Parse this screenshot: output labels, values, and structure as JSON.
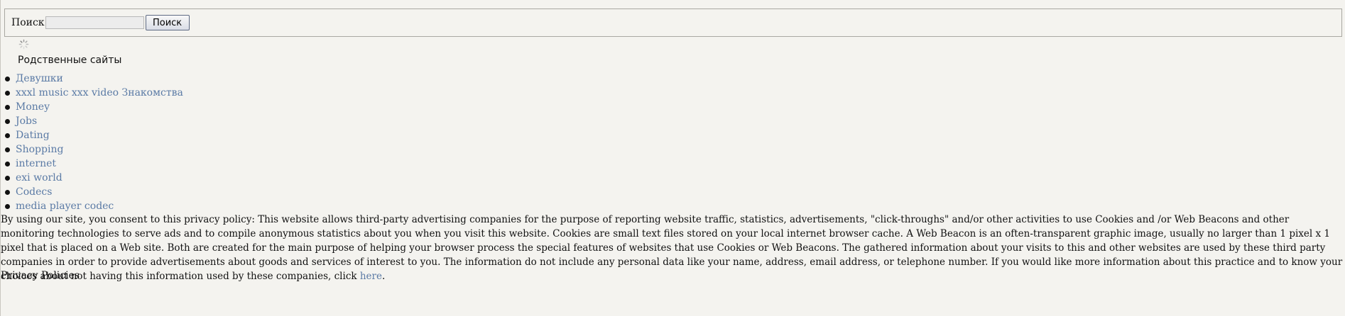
{
  "search": {
    "label": "Поиск",
    "input_value": "",
    "button_label": "Поиск"
  },
  "related": {
    "heading": "Родственные сайты",
    "links": [
      "Девушки",
      "xxxl music xxx video Знакомства",
      "Money",
      "Jobs",
      "Dating",
      "Shopping",
      "internet",
      "exi world",
      "Codecs",
      "media player codec"
    ]
  },
  "privacy": {
    "text": "By using our site, you consent to this privacy policy: This website allows third-party advertising companies for the purpose of reporting website traffic, statistics, advertisements, \"click-throughs\" and/or other activities to use Cookies and /or Web Beacons and other monitoring technologies to serve ads and to compile anonymous statistics about you when you visit this website. Cookies are small text files stored on your local internet browser cache. A Web Beacon is an often-transparent graphic image, usually no larger than 1 pixel x 1 pixel that is placed on a Web site. Both are created for the main purpose of helping your browser process the special features of websites that use Cookies or Web Beacons. The gathered information about your visits to this and other websites are used by these third party companies in order to provide advertisements about goods and services of interest to you. The information do not include any personal data like your name, address, email address, or telephone number. If you would like more information about this practice and to know your choices about not having this information used by these companies, click ",
    "link_label": "here",
    "after_link": ".",
    "policies_label": "Privacy Policies"
  },
  "colors": {
    "background": "#f4f3ef",
    "link": "#5a7aa5"
  }
}
